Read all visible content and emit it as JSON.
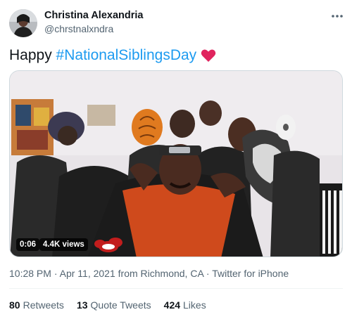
{
  "author": {
    "display_name": "Christina Alexandria",
    "handle": "@chrstnalxndra"
  },
  "tweet": {
    "text_prefix": "Happy ",
    "hashtag": "#NationalSiblingsDay",
    "emoji": "red-heart"
  },
  "video": {
    "duration": "0:06",
    "views": "4.4K views"
  },
  "meta": {
    "time": "10:28 PM",
    "sep1": " · ",
    "date": "Apr 11, 2021",
    "location_prefix": " from ",
    "location": "Richmond, CA",
    "sep2": " · ",
    "client": "Twitter for iPhone"
  },
  "stats": [
    {
      "count": "80",
      "label": "Retweets"
    },
    {
      "count": "13",
      "label": "Quote Tweets"
    },
    {
      "count": "424",
      "label": "Likes"
    }
  ],
  "colors": {
    "link": "#1d9bf0",
    "text": "#0f1419",
    "secondary": "#536471",
    "heart": "#e0245e"
  }
}
